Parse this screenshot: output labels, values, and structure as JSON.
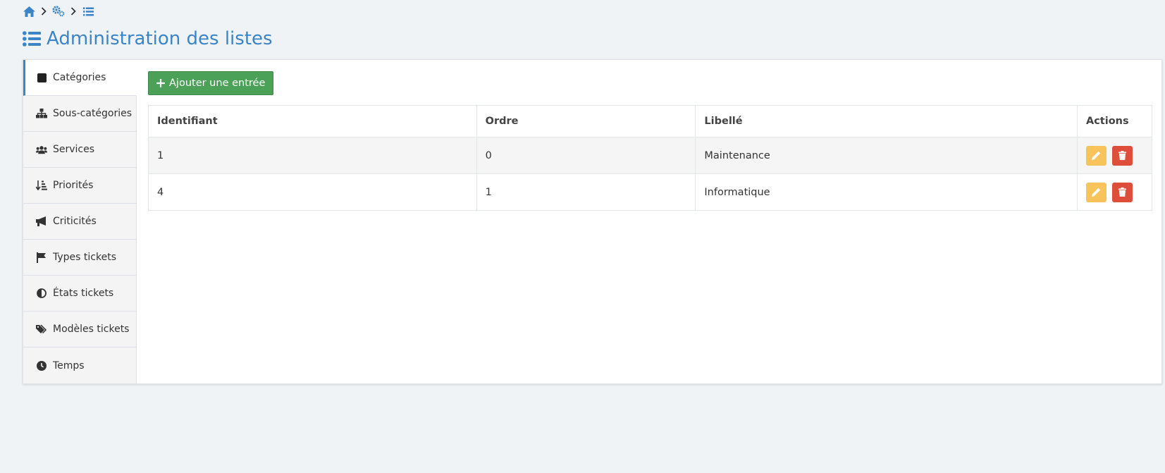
{
  "breadcrumb": {
    "items": [
      {
        "icon": "home-icon"
      },
      {
        "icon": "gears-icon"
      },
      {
        "icon": "list-icon"
      }
    ]
  },
  "page": {
    "title": "Administration des listes",
    "title_icon": "list-icon",
    "accent_color": "#3a85c8"
  },
  "sidebar": {
    "items": [
      {
        "label": "Catégories",
        "icon": "square-icon",
        "active": true
      },
      {
        "label": "Sous-catégories",
        "icon": "sitemap-icon",
        "active": false
      },
      {
        "label": "Services",
        "icon": "users-icon",
        "active": false
      },
      {
        "label": "Priorités",
        "icon": "sort-amount-icon",
        "active": false
      },
      {
        "label": "Criticités",
        "icon": "bullhorn-icon",
        "active": false
      },
      {
        "label": "Types tickets",
        "icon": "flag-icon",
        "active": false
      },
      {
        "label": "États tickets",
        "icon": "adjust-icon",
        "active": false
      },
      {
        "label": "Modèles tickets",
        "icon": "tags-icon",
        "active": false
      },
      {
        "label": "Temps",
        "icon": "clock-icon",
        "active": false
      }
    ]
  },
  "toolbar": {
    "add_label": "Ajouter une entrée",
    "add_color": "#4aa157"
  },
  "table": {
    "headers": [
      "Identifiant",
      "Ordre",
      "Libellé",
      "Actions"
    ],
    "rows": [
      {
        "id": "1",
        "ordre": "0",
        "libelle": "Maintenance"
      },
      {
        "id": "4",
        "ordre": "1",
        "libelle": "Informatique"
      }
    ],
    "edit_color": "#f7c35a",
    "delete_color": "#de4f3b"
  }
}
